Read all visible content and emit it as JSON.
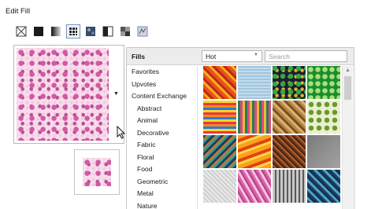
{
  "window": {
    "title": "Edit Fill"
  },
  "fill_types": [
    {
      "icon": "no-fill-icon"
    },
    {
      "icon": "solid-fill-icon"
    },
    {
      "icon": "gradient-fill-icon"
    },
    {
      "icon": "pattern-fill-icon",
      "selected": true
    },
    {
      "icon": "texture-fill-icon"
    },
    {
      "icon": "half-fill-icon"
    },
    {
      "icon": "bitmap-fill-icon"
    },
    {
      "icon": "postscript-fill-icon"
    }
  ],
  "fills_panel": {
    "label": "Fills",
    "dropdown_value": "Hot",
    "search_placeholder": "Search"
  },
  "categories": [
    {
      "label": "Favorites",
      "level": 0
    },
    {
      "label": "Upvotes",
      "level": 0
    },
    {
      "label": "Content Exchange",
      "level": 0
    },
    {
      "label": "Abstract",
      "level": 1
    },
    {
      "label": "Animal",
      "level": 1
    },
    {
      "label": "Decorative",
      "level": 1
    },
    {
      "label": "Fabric",
      "level": 1
    },
    {
      "label": "Floral",
      "level": 1
    },
    {
      "label": "Food",
      "level": 1
    },
    {
      "label": "Geometric",
      "level": 1
    },
    {
      "label": "Metal",
      "level": 1
    },
    {
      "label": "Nature",
      "level": 1
    }
  ]
}
